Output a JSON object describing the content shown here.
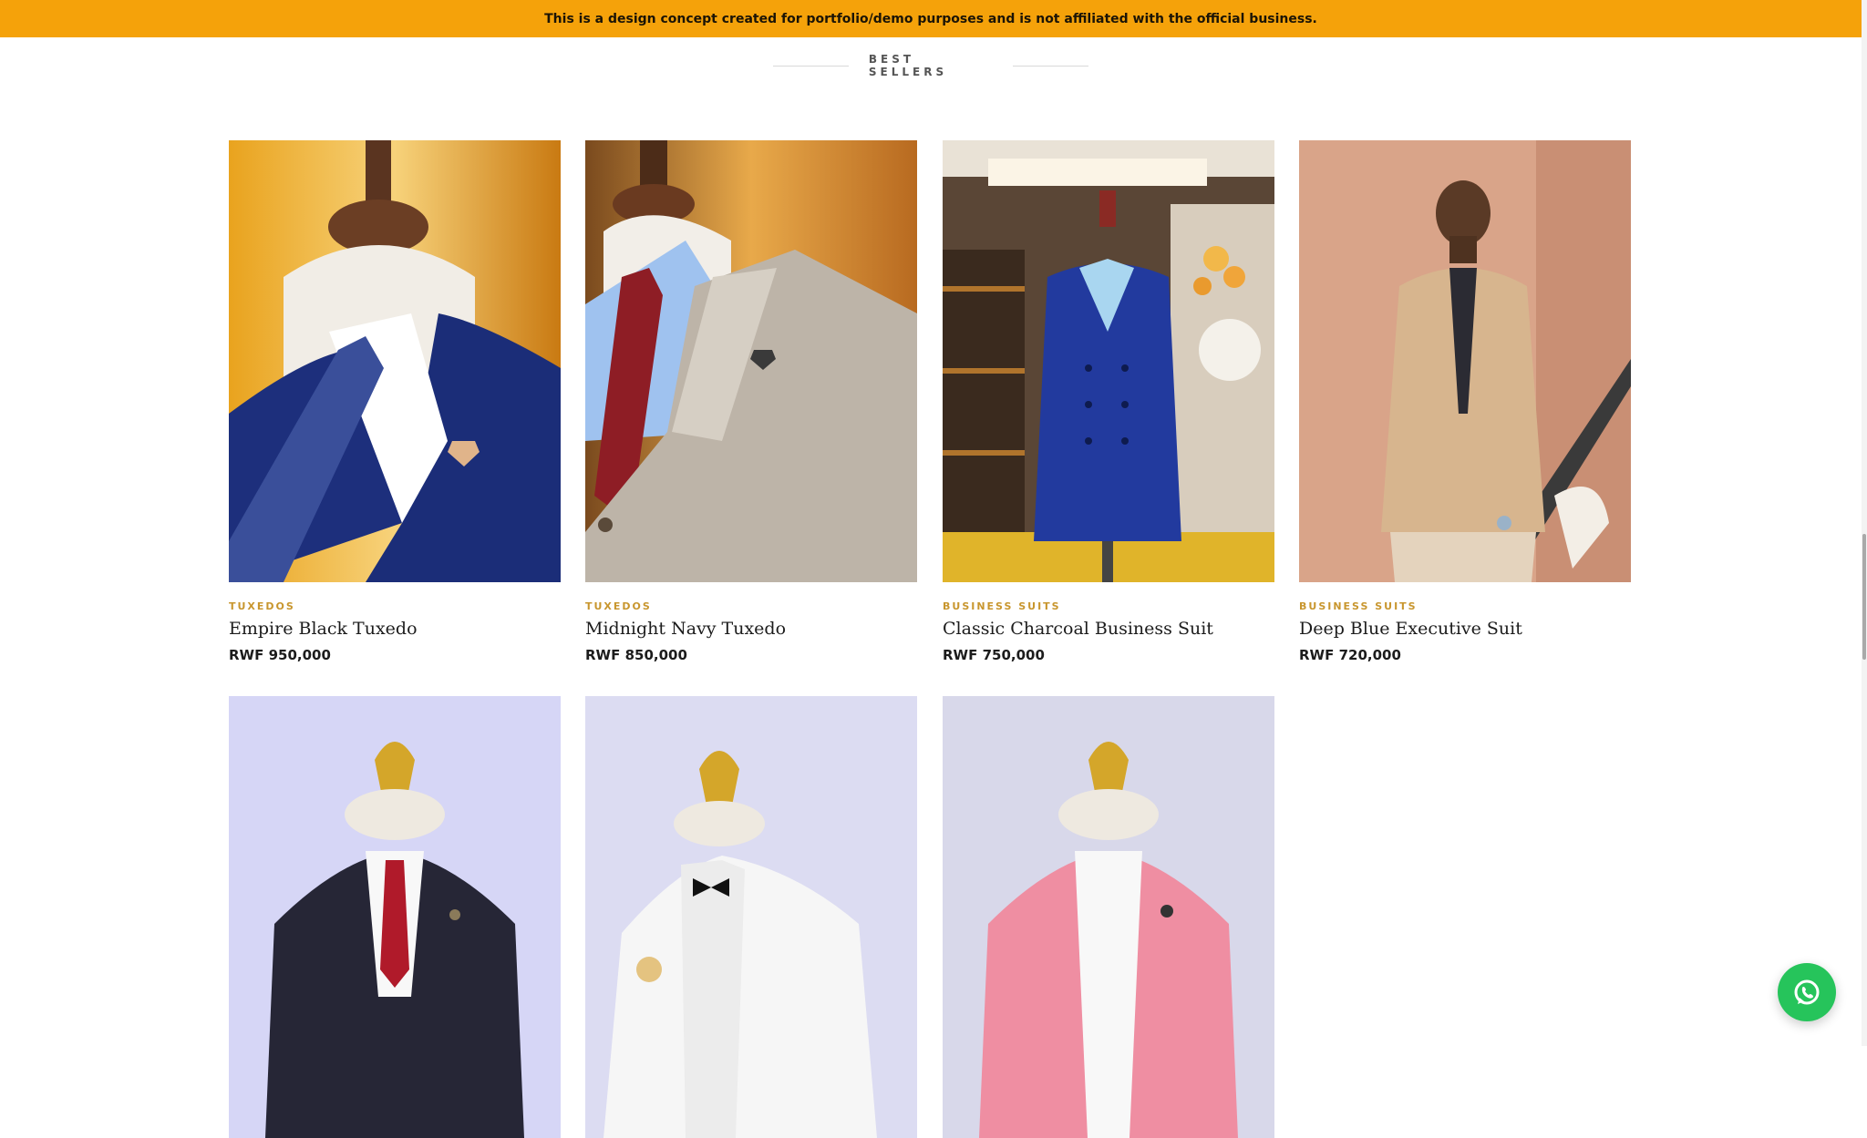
{
  "banner": {
    "text": "This is a design concept created for portfolio/demo purposes and is not affiliated with the official business."
  },
  "section": {
    "title": "BEST SELLERS"
  },
  "products": [
    {
      "category": "TUXEDOS",
      "name": "Empire Black Tuxedo",
      "price": "RWF 950,000"
    },
    {
      "category": "TUXEDOS",
      "name": "Midnight Navy Tuxedo",
      "price": "RWF 850,000"
    },
    {
      "category": "BUSINESS SUITS",
      "name": "Classic Charcoal Business Suit",
      "price": "RWF 750,000"
    },
    {
      "category": "BUSINESS SUITS",
      "name": "Deep Blue Executive Suit",
      "price": "RWF 720,000"
    }
  ],
  "colors": {
    "banner": "#f5a20a",
    "category": "#c8962e",
    "whatsapp": "#26c45b"
  },
  "icons": {
    "chat": "whatsapp-icon"
  }
}
